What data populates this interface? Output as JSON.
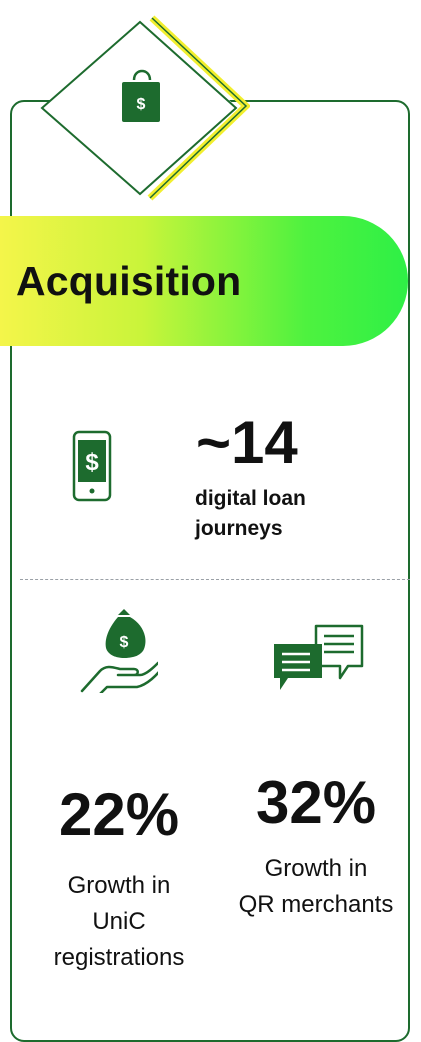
{
  "banner": {
    "title": "Acquisition"
  },
  "header_icon": {
    "name": "shopping-bag-dollar-icon",
    "glyph": "$"
  },
  "stats": {
    "loans": {
      "value": "~14",
      "label_line1": "digital loan",
      "label_line2": "journeys",
      "icon": "mobile-dollar-icon"
    },
    "unic": {
      "value": "22%",
      "label_line1": "Growth in",
      "label_line2": "UniC",
      "label_line3": "registrations",
      "icon": "hand-money-bag-icon"
    },
    "qr": {
      "value": "32%",
      "label_line1": "Growth in",
      "label_line2": "QR merchants",
      "icon": "chat-bubbles-icon"
    }
  },
  "colors": {
    "brand_green": "#1d6b2e",
    "accent_yellow": "#f2ef2e",
    "banner_start": "#f4f54a",
    "banner_end": "#2ef046"
  }
}
